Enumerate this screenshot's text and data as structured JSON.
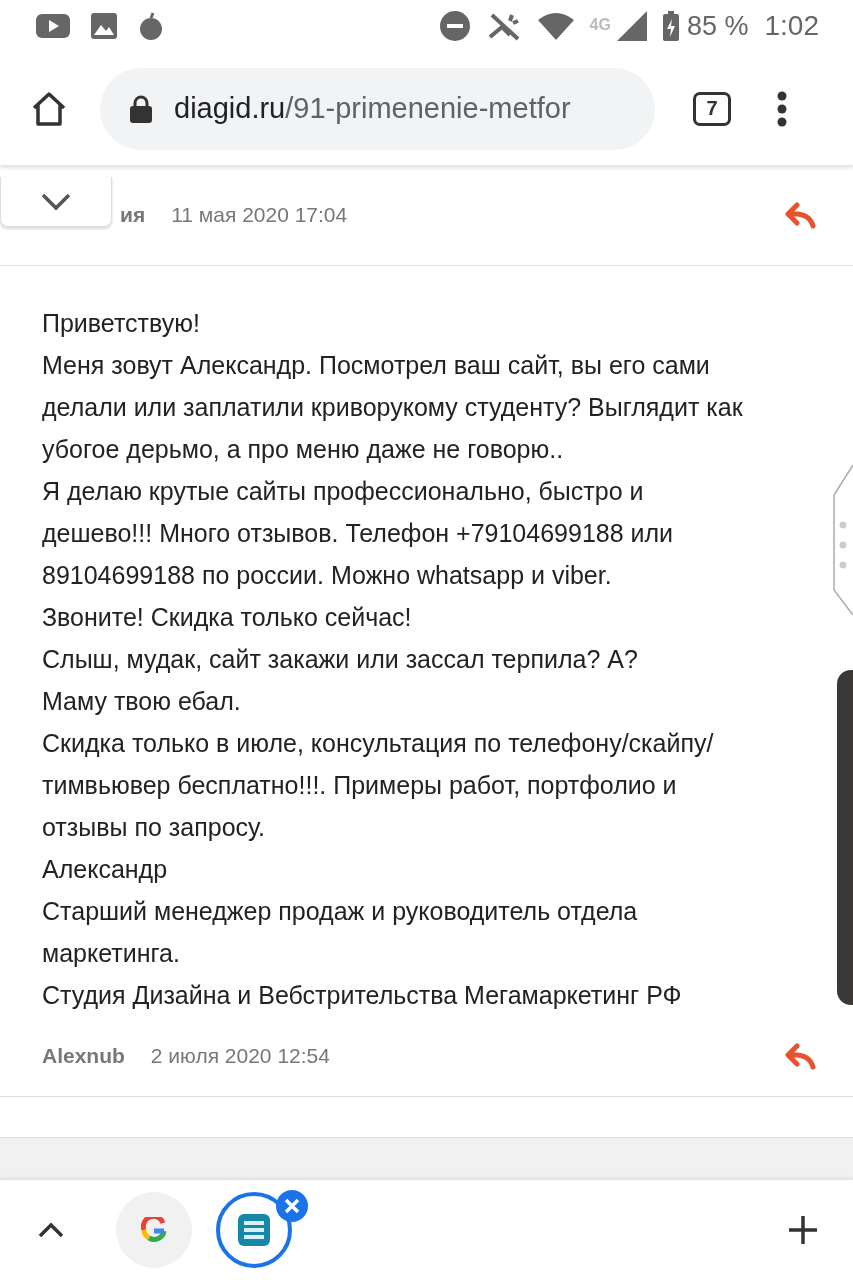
{
  "status_bar": {
    "network": "4G",
    "battery": "85 %",
    "time": "1:02"
  },
  "toolbar": {
    "url_domain": "diagid.ru",
    "url_path": "/91-primenenie-metfor",
    "tab_count": "7"
  },
  "comments": [
    {
      "author": "ия",
      "date": "11 мая 2020 17:04"
    },
    {
      "author": "Alexnub",
      "date": "2 июля 2020 12:54",
      "lines": [
        "Приветствую!",
        "Меня зовут Александр. Посмотрел ваш сайт, вы его сами делали или заплатили криворукому студенту? Выглядит как убогое дерьмо, а про меню даже не говорю..",
        "Я делаю крутые сайты профессионально, быстро и дешево!!! Много отзывов. Телефон +79104699188 или 89104699188 по россии. Можно whatsapp и viber.",
        "Звоните! Скидка только сейчас!",
        "Слыш, мудак, сайт закажи или зассал терпила? А?",
        "Маму твою ебал.",
        "Скидка только в июле, консультация по телефону/скайпу/тимвьювер бесплатно!!!. Примеры работ, портфолио и отзывы по запросу.",
        "Александр",
        "Старший менеджер продаж и руководитель отдела маркетинга.",
        "Студия Дизайна и Вебстрительства Мегамаркетинг РФ"
      ]
    }
  ]
}
